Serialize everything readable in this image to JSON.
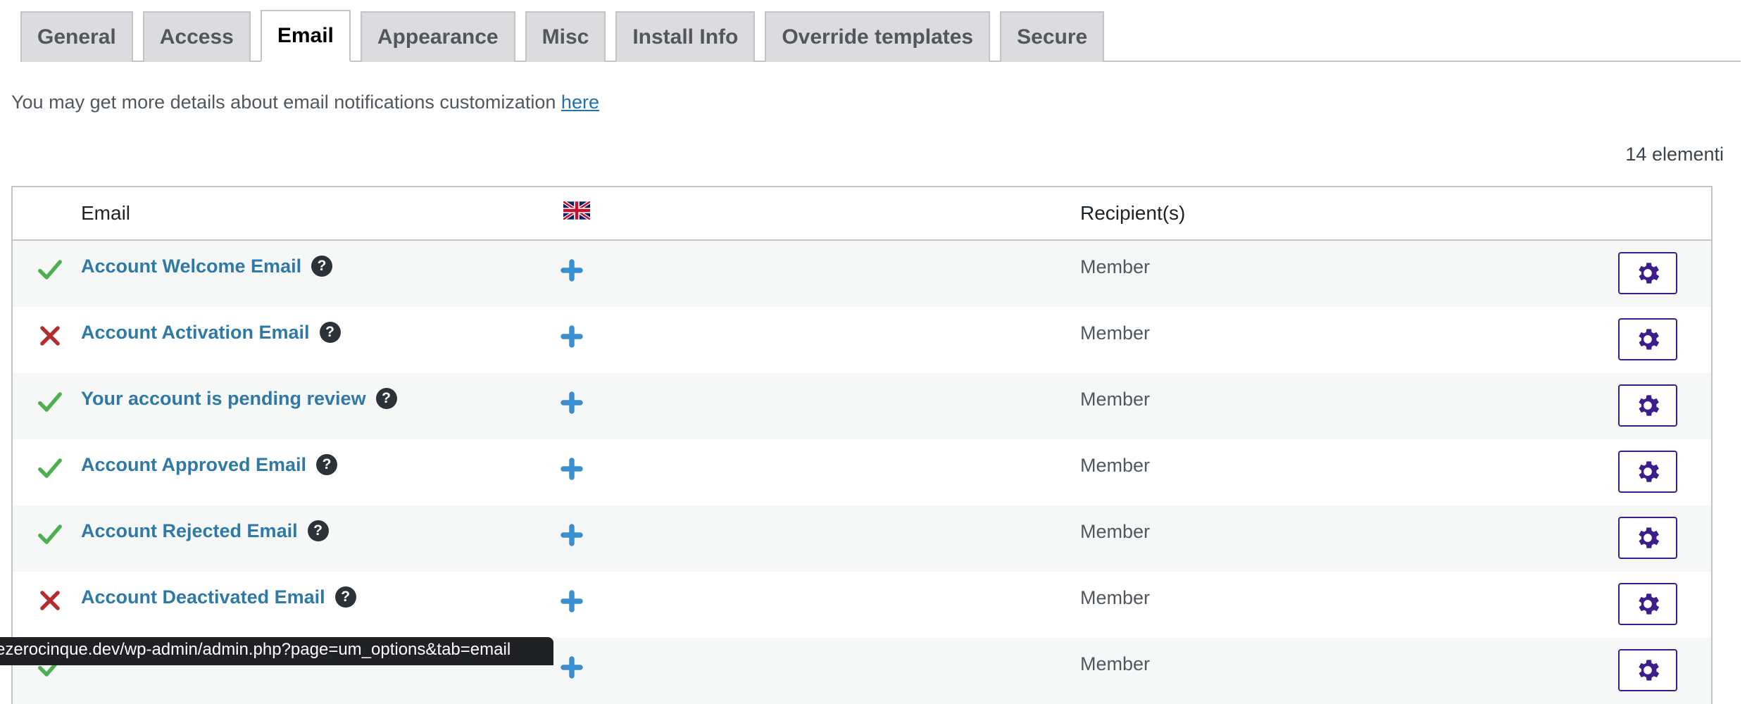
{
  "tabs": [
    {
      "label": "General",
      "active": false
    },
    {
      "label": "Access",
      "active": false
    },
    {
      "label": "Email",
      "active": true
    },
    {
      "label": "Appearance",
      "active": false
    },
    {
      "label": "Misc",
      "active": false
    },
    {
      "label": "Install Info",
      "active": false
    },
    {
      "label": "Override templates",
      "active": false
    },
    {
      "label": "Secure",
      "active": false
    }
  ],
  "intro": {
    "text": "You may get more details about email notifications customization ",
    "link_label": "here"
  },
  "item_count": "14 elementi",
  "table": {
    "columns": {
      "email": "Email",
      "language_flag_icon": "uk-flag-icon",
      "recipients": "Recipient(s)"
    },
    "rows": [
      {
        "status": "enabled",
        "name": "Account Welcome Email",
        "recipient": "Member"
      },
      {
        "status": "disabled",
        "name": "Account Activation Email",
        "recipient": "Member"
      },
      {
        "status": "enabled",
        "name": "Your account is pending review",
        "recipient": "Member"
      },
      {
        "status": "enabled",
        "name": "Account Approved Email",
        "recipient": "Member"
      },
      {
        "status": "enabled",
        "name": "Account Rejected Email",
        "recipient": "Member"
      },
      {
        "status": "disabled",
        "name": "Account Deactivated Email",
        "recipient": "Member"
      },
      {
        "status": "enabled",
        "name": "",
        "recipient": "Member"
      }
    ]
  },
  "status_bar_url": "ezerocinque.dev/wp-admin/admin.php?page=um_options&tab=email",
  "colors": {
    "link": "#2e79a6",
    "enabled_check": "#4caf50",
    "disabled_cross": "#b32d2e",
    "gear_accent": "#3b1e8c",
    "plus_icon": "#3a8fd0"
  }
}
